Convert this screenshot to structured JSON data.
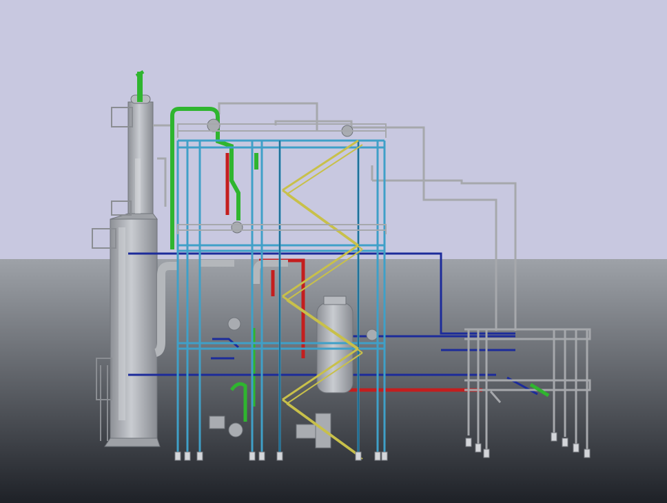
{
  "viewport": {
    "background": {
      "sky_color": "#c8c8e0",
      "ground_top_color": "#9ea2a8",
      "ground_bottom_color": "#1e2127"
    }
  },
  "colors": {
    "steel_structure": "#3fa0c8",
    "steel_dark": "#1f6f96",
    "stairs": "#c8c04a",
    "pipe_green": "#2fb52f",
    "pipe_red": "#c41e1e",
    "pipe_blue": "#1c2b9a",
    "pipe_gray": "#a6a8ac",
    "vessel": "#b9bcc1",
    "vessel_shade": "#8d9096",
    "footing": "#d4d6da"
  }
}
